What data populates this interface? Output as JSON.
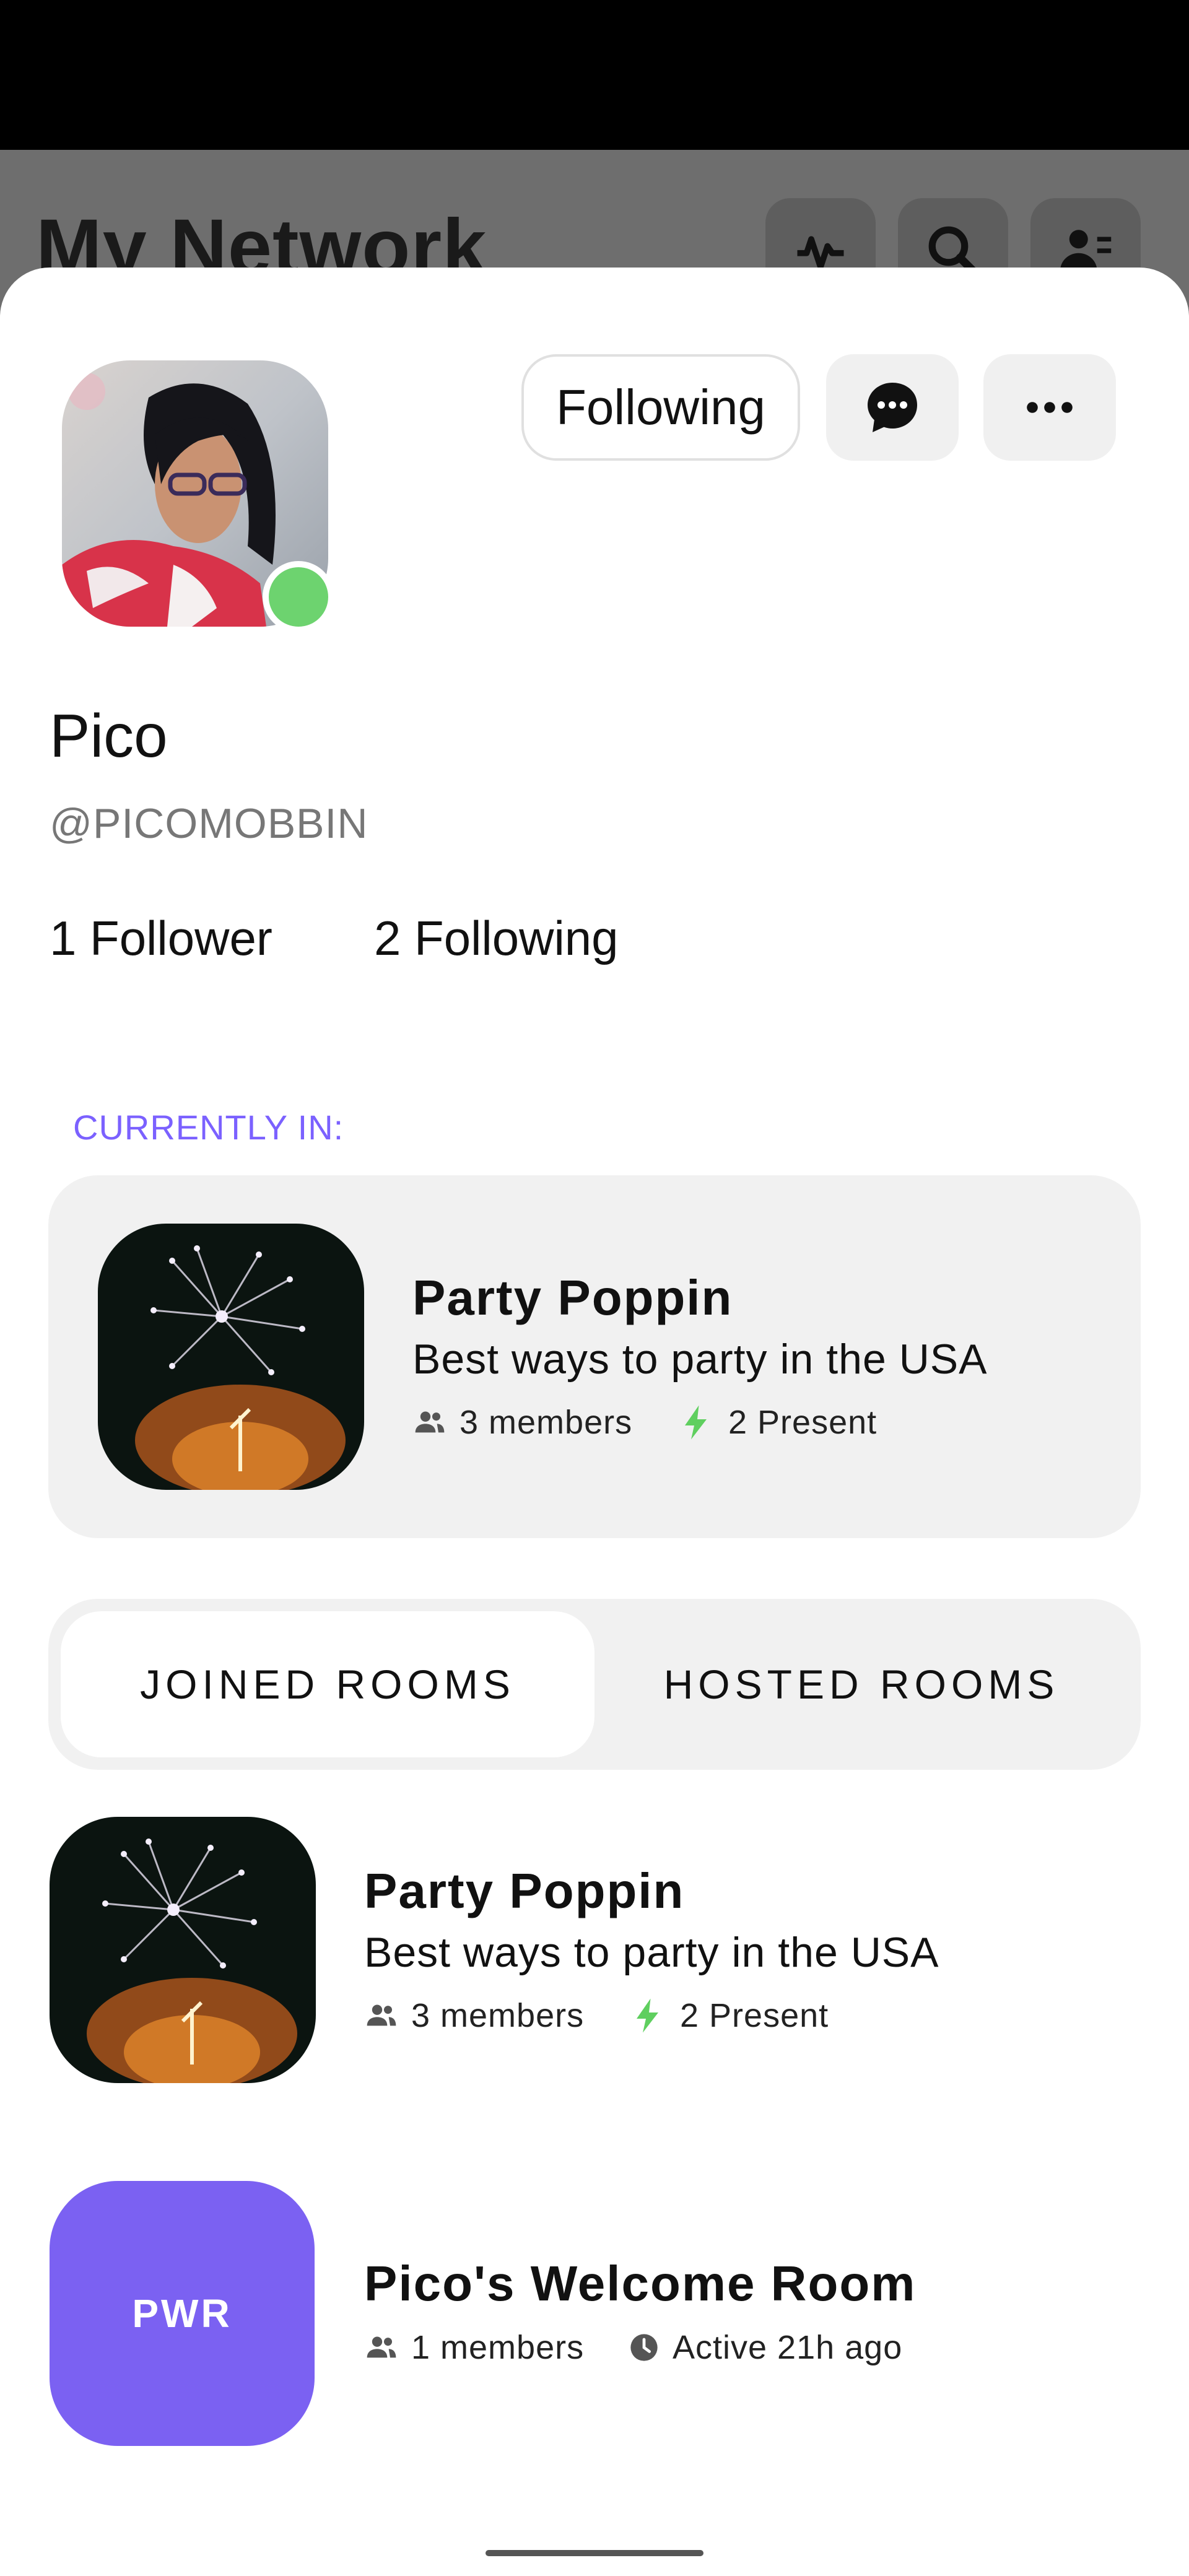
{
  "background": {
    "title": "My Network"
  },
  "profile": {
    "name": "Pico",
    "handle": "@PICOMOBBIN",
    "followers_label": "1 Follower",
    "following_label": "2 Following",
    "follow_button_label": "Following",
    "online": true
  },
  "currently_in": {
    "label": "CURRENTLY IN:",
    "room": {
      "title": "Party Poppin",
      "description": "Best ways to party in the USA",
      "members": "3 members",
      "present": "2 Present"
    }
  },
  "tabs": {
    "joined": "JOINED ROOMS",
    "hosted": "HOSTED ROOMS",
    "selected": "joined"
  },
  "rooms": [
    {
      "title": "Party Poppin",
      "description": "Best ways to party in the USA",
      "members": "3 members",
      "present": "2 Present"
    },
    {
      "thumb_text": "PWR",
      "title": "Pico's Welcome Room",
      "members": "1 members",
      "activity": "Active 21h ago"
    }
  ],
  "colors": {
    "accent": "#7b61ff",
    "online": "#6dd36f",
    "present": "#5fcf5f",
    "pwr_thumb": "#7b61f2"
  }
}
